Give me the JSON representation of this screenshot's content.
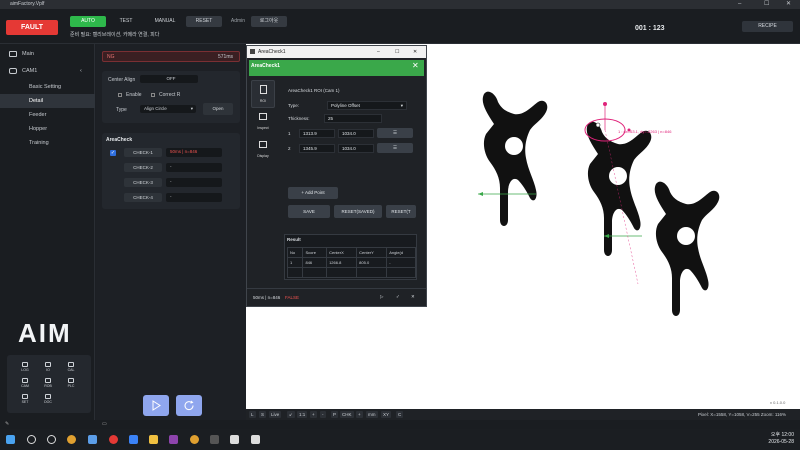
{
  "window": {
    "title": "aimFactory.Vplf"
  },
  "topbar": {
    "fault_label": "FAULT",
    "modes": [
      {
        "label": "AUTO",
        "color": "#2eb84b"
      },
      {
        "label": "TEST"
      },
      {
        "label": "MANUAL"
      },
      {
        "label": "RESET"
      }
    ],
    "user": "Admin",
    "logout_label": "로그아웃",
    "message": "준비 필요: 캘리브레이션, 카메라 연결, 피다",
    "counter": "001 : 123",
    "recipe_label": "RECIPE"
  },
  "nav": {
    "items": [
      {
        "label": "Main"
      },
      {
        "label": "CAM1"
      },
      {
        "label": "Basic Setting"
      },
      {
        "label": "Detail"
      },
      {
        "label": "Feeder"
      },
      {
        "label": "Hopper"
      },
      {
        "label": "Training"
      }
    ],
    "logo": "AIM",
    "tools": [
      {
        "label": "LOG"
      },
      {
        "label": "IO"
      },
      {
        "label": "CAL"
      },
      {
        "label": "CAM"
      },
      {
        "label": "ROB"
      },
      {
        "label": "PLC"
      },
      {
        "label": "SET"
      },
      {
        "label": "DOC"
      }
    ]
  },
  "panel": {
    "status_tag": "NG",
    "status_time": "571ms",
    "center_align_label": "Center Align",
    "center_align_value": "OFF",
    "enable_label": "Enable",
    "correct_r_label": "Correct R",
    "type_label": "Type",
    "type_value": "Align Circle",
    "open_label": "Open",
    "areacheck_title": "AreaCheck",
    "checks": [
      {
        "label": "CHECK-1",
        "result": "50ms | n=846",
        "checked": true
      },
      {
        "label": "CHECK-2",
        "result": "-",
        "checked": false
      },
      {
        "label": "CHECK-3",
        "result": "-",
        "checked": false
      },
      {
        "label": "CHECK-4",
        "result": "-",
        "checked": false
      }
    ]
  },
  "dialog": {
    "title": "AreaCheck1",
    "header": "AreaCheck1",
    "tabs": [
      {
        "label": "ROI"
      },
      {
        "label": "Inspect"
      },
      {
        "label": "Display"
      }
    ],
    "roi_title": "AreaCheck1 ROI (Cam 1)",
    "type_label": "Type:",
    "type_value": "Polyline Offset",
    "thickness_label": "Thickness:",
    "thickness_value": "25",
    "points": [
      {
        "idx": "1",
        "x": "1313.9",
        "y": "1034.0",
        "del": "☰"
      },
      {
        "idx": "2",
        "x": "1345.9",
        "y": "1034.0",
        "del": "☰"
      }
    ],
    "add_point_label": "+ Add Point",
    "save_label": "SAVE",
    "reset_saved_label": "RESET(SAVED)",
    "reset_t_label": "RESET(T",
    "result_title": "Result",
    "result_columns": [
      "No",
      "Score",
      "CenterX",
      "CenterY",
      "Angle(d"
    ],
    "result_rows": [
      [
        "1",
        "846",
        "1266.8",
        "805.0",
        "-"
      ]
    ],
    "footer_time": "50ms | n=846",
    "footer_status": "FALSE"
  },
  "viewer": {
    "annotation": "1 : dx=63.1, dy=-2263 | n=846",
    "bottom_buttons": [
      "L",
      "S",
      "Live",
      "↙",
      "1:1",
      "+",
      "-",
      "P",
      "CHK",
      "+",
      "mm",
      "XY",
      "C"
    ],
    "pixel_info": "Pixel: X=1558, Y=1058, V=255   Zoom: 116%",
    "version": "v 0.1.0.0"
  },
  "taskbar": {
    "time": "오후 12:00",
    "date": "2026-05-28"
  }
}
